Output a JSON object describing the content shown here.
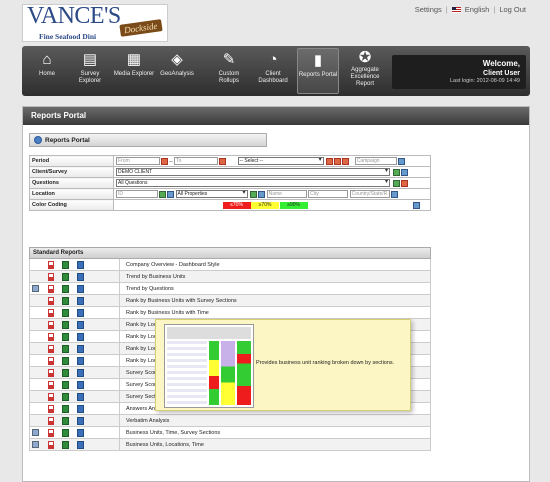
{
  "logo": {
    "main": "VANCE'S",
    "sub": "Fine Seafood Dini",
    "badge": "Dockside"
  },
  "toplinks": {
    "settings": "Settings",
    "language": "English",
    "logout": "Log Out"
  },
  "nav": [
    {
      "label": "Home",
      "icon": "home-icon",
      "glyph": "⌂"
    },
    {
      "label": "Survey Explorer",
      "icon": "document-icon",
      "glyph": "▤"
    },
    {
      "label": "Media Explorer",
      "icon": "image-icon",
      "glyph": "▦"
    },
    {
      "label": "GeoAnalysis",
      "icon": "map-icon",
      "glyph": "◈"
    },
    {
      "label": "Custom Rollups",
      "icon": "pencil-icon",
      "glyph": "✎"
    },
    {
      "label": "Client Dashboard",
      "icon": "gauge-icon",
      "glyph": "◔"
    },
    {
      "label": "Reports Portal",
      "icon": "chart-icon",
      "glyph": "▮"
    },
    {
      "label": "Aggregate Excellence Report",
      "icon": "award-icon",
      "glyph": "✪"
    }
  ],
  "welcome": {
    "title": "Welcome,",
    "user": "Client User",
    "last_login": "Last login: 2012-08-09 14:49"
  },
  "page_title": "Reports Portal",
  "portal_tab": "Reports Portal",
  "filters": {
    "period_label": "Period",
    "from_placeholder": "From",
    "to_placeholder": "To",
    "period_select": "-- Select --",
    "campaign_placeholder": "Campaign",
    "client_label": "Client/Survey",
    "client_value": "DEMO CLIENT",
    "questions_label": "Questions",
    "questions_value": "All Questions",
    "location_label": "Location",
    "id_placeholder": "ID",
    "properties_value": "All Properties",
    "name_placeholder": "Name",
    "city_placeholder": "City",
    "country_placeholder": "Country/State/R",
    "color_label": "Color Coding",
    "red_text": "≤70%",
    "yellow_text": "≥70%",
    "green_text": "≥90%"
  },
  "std_reports_title": "Standard Reports",
  "reports": [
    {
      "name": "Company Overview - Dashboard Style",
      "has_chk": false
    },
    {
      "name": "Trend by Business Units",
      "has_chk": false
    },
    {
      "name": "Trend by Questions",
      "has_chk": true
    },
    {
      "name": "Rank by Business Units with Survey Sections",
      "has_chk": false
    },
    {
      "name": "Rank by Business Units with Time",
      "has_chk": false
    },
    {
      "name": "Rank by Loca",
      "has_chk": false
    },
    {
      "name": "Rank by Loca",
      "has_chk": false
    },
    {
      "name": "Rank by Loca",
      "has_chk": false
    },
    {
      "name": "Rank by Loca",
      "has_chk": false
    },
    {
      "name": "Survey Score",
      "has_chk": false
    },
    {
      "name": "Survey Score",
      "has_chk": false
    },
    {
      "name": "Survey Secti",
      "has_chk": false
    },
    {
      "name": "Answers Analysis",
      "has_chk": false
    },
    {
      "name": "Verbatim Analysis",
      "has_chk": false
    },
    {
      "name": "Business Units, Time, Survey Sections",
      "has_chk": true
    },
    {
      "name": "Business Units, Locations, Time",
      "has_chk": true
    }
  ],
  "tooltip": {
    "text": "Provides business unit ranking broken down by sections."
  }
}
